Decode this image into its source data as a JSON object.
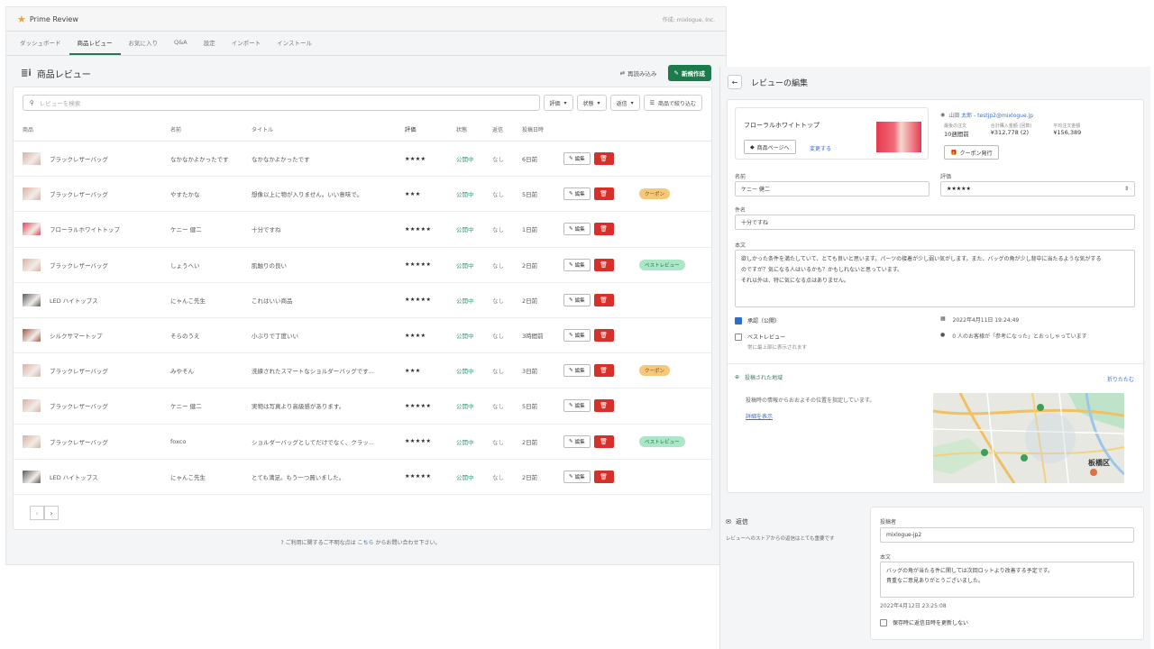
{
  "app": {
    "name": "Prime Review",
    "author": "作成: mixlogue, Inc."
  },
  "tabs": [
    "ダッシュボード",
    "商品レビュー",
    "お気に入り",
    "Q&A",
    "設定",
    "インポート",
    "インストール"
  ],
  "page": {
    "title": "商品レビュー",
    "reload": "再読み込み",
    "new": "新規作成"
  },
  "filter": {
    "search_placeholder": "レビューを検索",
    "rating": "評価",
    "state": "状態",
    "reply": "返信",
    "by_product": "商品で絞り込む"
  },
  "columns": [
    "商品",
    "名前",
    "タイトル",
    "評価",
    "状態",
    "返信",
    "投稿日時"
  ],
  "actions": {
    "edit": "編集"
  },
  "rows": [
    {
      "product": "ブラックレザーバッグ",
      "name": "なかなかよかったです",
      "title": "なかなかよかったです",
      "stars": "★★★★",
      "state": "公開中",
      "reply": "なし",
      "date": "6日前",
      "badge": "",
      "thumb": "#d8b0a3"
    },
    {
      "product": "ブラックレザーバッグ",
      "name": "やすたかな",
      "title": "想像以上に物が入りません。いい意味で。",
      "stars": "★★★",
      "state": "公開中",
      "reply": "なし",
      "date": "5日前",
      "badge": "クーポン",
      "thumb": "#d8b0a3"
    },
    {
      "product": "フローラルホワイトトップ",
      "name": "ケニー 健二",
      "title": "十分ですね",
      "stars": "★★★★★",
      "state": "公開中",
      "reply": "なし",
      "date": "1日前",
      "badge": "",
      "thumb": "#e04456"
    },
    {
      "product": "ブラックレザーバッグ",
      "name": "しょうへい",
      "title": "肌触りの良い",
      "stars": "★★★★★",
      "state": "公開中",
      "reply": "なし",
      "date": "2日前",
      "badge": "ベストレビュー",
      "thumb": "#d8b0a3"
    },
    {
      "product": "LED ハイトップス",
      "name": "にゃんこ先生",
      "title": "これはいい商品",
      "stars": "★★★★★",
      "state": "公開中",
      "reply": "なし",
      "date": "2日前",
      "badge": "",
      "thumb": "#5a5a5a"
    },
    {
      "product": "シルクサマートップ",
      "name": "そらのうえ",
      "title": "小ぶりで丁度いい",
      "stars": "★★★★",
      "state": "公開中",
      "reply": "なし",
      "date": "3時間前",
      "badge": "",
      "thumb": "#a05a4a"
    },
    {
      "product": "ブラックレザーバッグ",
      "name": "みやそん",
      "title": "洗練されたスマートなショルダーバッグです...",
      "stars": "★★★",
      "state": "公開中",
      "reply": "なし",
      "date": "3日前",
      "badge": "クーポン",
      "thumb": "#d8b0a3"
    },
    {
      "product": "ブラックレザーバッグ",
      "name": "ケニー 健二",
      "title": "実物は写真より高級感があります。",
      "stars": "★★★★★",
      "state": "公開中",
      "reply": "なし",
      "date": "5日前",
      "badge": "",
      "thumb": "#d8b0a3"
    },
    {
      "product": "ブラックレザーバッグ",
      "name": "foxco",
      "title": "ショルダーバッグとしてだけでなく、クラッ...",
      "stars": "★★★★★",
      "state": "公開中",
      "reply": "なし",
      "date": "2日前",
      "badge": "ベストレビュー",
      "thumb": "#d8b0a3"
    },
    {
      "product": "LED ハイトップス",
      "name": "にゃんこ先生",
      "title": "とても満足。もう一つ買いました。",
      "stars": "★★★★★",
      "state": "公開中",
      "reply": "なし",
      "date": "2日前",
      "badge": "",
      "thumb": "#5a5a5a"
    }
  ],
  "footer": {
    "pre": "ご利用に関するご不明な点は",
    "link": "こちら",
    "post": "からお問い合わせ下さい。"
  },
  "edit": {
    "title": "レビューの編集",
    "product": "フローラルホワイトトップ",
    "product_page": "商品ページへ",
    "change": "変更する",
    "user": "山田 太郎 - testjp2@mixlogue.jp",
    "stats": [
      {
        "label": "最後の注文",
        "value": "10週間前"
      },
      {
        "label": "合計購入金額 (回数)",
        "value": "¥312,778 (2)"
      },
      {
        "label": "平均注文金額",
        "value": "¥156,389"
      }
    ],
    "coupon": "クーポン発行",
    "name_label": "名前",
    "name": "ケニー 健二",
    "rating_label": "評価",
    "rating": "★★★★★",
    "subject_label": "件名",
    "subject": "十分ですね",
    "body_label": "本文",
    "body": [
      "欲しかった条件を満たしていて、とても良いと思います。パーツの接着が少し弱い気がします。また、バッグの角が少し背中に当たるような気がする",
      "のですが？気になる人はいるかも？かもしれないと思っています。",
      "それ以外は、特に気になる点はありません。"
    ],
    "approve": "承認（公開）",
    "best": "ベストレビュー",
    "best_note": "常に最上部に表示されます",
    "posted": "2022年4月11日 19:24:49",
    "helpful": "0 人のお客様が「参考になった」とおっしゃっています",
    "region_title": "投稿された地域",
    "collapse": "折りたたむ",
    "region_note": "投稿時の情報からおおよその位置を指定しています。",
    "details": "詳細を表示",
    "map_label": "板橋区"
  },
  "reply": {
    "title": "返信",
    "note": "レビューへのストアからの返信はとても重要です",
    "poster_label": "投稿者",
    "poster": "mixlogue-jp2",
    "body_label": "本文",
    "body": [
      "バッグの角が当たる件に関しては次回ロットより改善する予定です。",
      "貴重なご意見ありがとうございました。"
    ],
    "date": "2022年4月12日 23:25:08",
    "no_update": "保存時に返信日時を更新しない"
  }
}
